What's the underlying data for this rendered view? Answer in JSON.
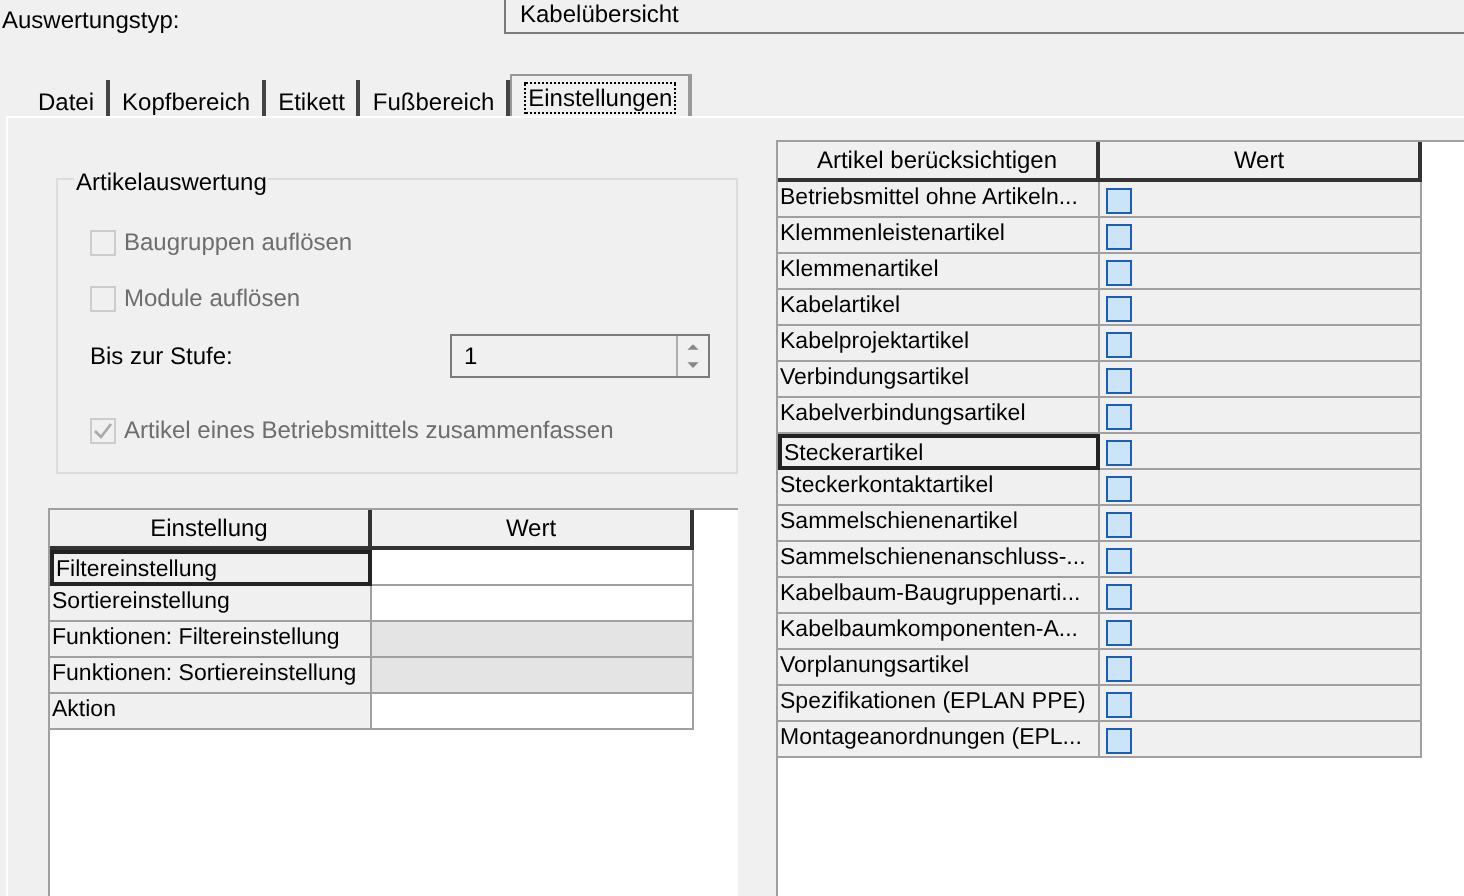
{
  "header": {
    "label": "Auswertungstyp:",
    "value": "Kabelübersicht"
  },
  "tabs": [
    {
      "label": "Datei",
      "selected": false
    },
    {
      "label": "Kopfbereich",
      "selected": false
    },
    {
      "label": "Etikett",
      "selected": false
    },
    {
      "label": "Fußbereich",
      "selected": false
    },
    {
      "label": "Einstellungen",
      "selected": true
    }
  ],
  "group": {
    "title": "Artikelauswertung",
    "checkboxes": [
      {
        "label": "Baugruppen auflösen",
        "checked": false,
        "disabled": true
      },
      {
        "label": "Module auflösen",
        "checked": false,
        "disabled": true
      }
    ],
    "level": {
      "label": "Bis zur Stufe:",
      "value": "1"
    },
    "summary": {
      "label": "Artikel eines Betriebsmittels zusammenfassen",
      "checked": true,
      "disabled": true
    }
  },
  "settings_table": {
    "columns": [
      "Einstellung",
      "Wert"
    ],
    "rows": [
      {
        "name": "Filtereinstellung",
        "selected": true,
        "disabled": false
      },
      {
        "name": "Sortiereinstellung",
        "selected": false,
        "disabled": false
      },
      {
        "name": "Funktionen: Filtereinstellung",
        "selected": false,
        "disabled": true
      },
      {
        "name": "Funktionen: Sortiereinstellung",
        "selected": false,
        "disabled": true
      },
      {
        "name": "Aktion",
        "selected": false,
        "disabled": false
      }
    ]
  },
  "articles_table": {
    "columns": [
      "Artikel berücksichtigen",
      "Wert"
    ],
    "rows": [
      {
        "name": "Betriebsmittel ohne Artikeln...",
        "selected": false,
        "checked": false
      },
      {
        "name": "Klemmenleistenartikel",
        "selected": false,
        "checked": false
      },
      {
        "name": "Klemmenartikel",
        "selected": false,
        "checked": false
      },
      {
        "name": "Kabelartikel",
        "selected": false,
        "checked": false
      },
      {
        "name": "Kabelprojektartikel",
        "selected": false,
        "checked": false
      },
      {
        "name": "Verbindungsartikel",
        "selected": false,
        "checked": false
      },
      {
        "name": "Kabelverbindungsartikel",
        "selected": false,
        "checked": false
      },
      {
        "name": "Steckerartikel",
        "selected": true,
        "checked": false
      },
      {
        "name": "Steckerkontaktartikel",
        "selected": false,
        "checked": false
      },
      {
        "name": "Sammelschienenartikel",
        "selected": false,
        "checked": false
      },
      {
        "name": "Sammelschienenanschluss-...",
        "selected": false,
        "checked": false
      },
      {
        "name": "Kabelbaum-Baugruppenarti...",
        "selected": false,
        "checked": false
      },
      {
        "name": "Kabelbaumkomponenten-A...",
        "selected": false,
        "checked": false
      },
      {
        "name": "Vorplanungsartikel",
        "selected": false,
        "checked": false
      },
      {
        "name": "Spezifikationen (EPLAN PPE)",
        "selected": false,
        "checked": false
      },
      {
        "name": "Montageanordnungen (EPL...",
        "selected": false,
        "checked": false
      }
    ]
  }
}
